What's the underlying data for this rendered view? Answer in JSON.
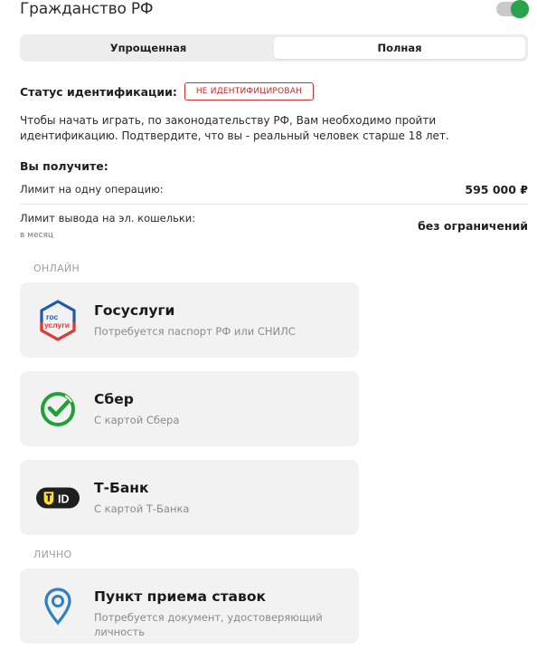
{
  "header": {
    "title": "Гражданство РФ",
    "toggle_on": true,
    "toggle_color": "#2aa14b"
  },
  "tabs": [
    {
      "label": "Упрощенная",
      "active": false
    },
    {
      "label": "Полная",
      "active": true
    }
  ],
  "status": {
    "label": "Статус идентификации:",
    "badge": "НЕ ИДЕНТИФИЦИРОВАН",
    "badge_color": "#d32f2f"
  },
  "description": "Чтобы начать играть, по законодательству РФ, Вам необходимо пройти идентификацию. Подтвердите, что вы - реальный человек старше 18 лет.",
  "receive": {
    "title": "Вы получите:",
    "limits": [
      {
        "label": "Лимит на одну операцию:",
        "value": "595 000 ₽"
      },
      {
        "label": "Лимит вывода на эл. кошельки:",
        "sublabel": "в месяц",
        "value": "без ограничений"
      }
    ]
  },
  "sections": {
    "online": "ОНЛАЙН",
    "personal": "ЛИЧНО"
  },
  "methods": [
    {
      "title": "Госуслуги",
      "subtitle": "Потребуется паспорт РФ или СНИЛС",
      "icon": "gosuslugi-icon",
      "icon_text_top": "гос",
      "icon_text_bottom": "услуги"
    },
    {
      "title": "Сбер",
      "subtitle": "С картой Сбера",
      "icon": "sber-icon"
    },
    {
      "title": "Т-Банк",
      "subtitle": "С картой Т-Банка",
      "icon": "tbank-id-icon",
      "icon_text": "ID"
    },
    {
      "title": "Пункт приема ставок",
      "subtitle": "Потребуется документ, удостоверяющий личность",
      "icon": "location-pin-icon"
    }
  ]
}
